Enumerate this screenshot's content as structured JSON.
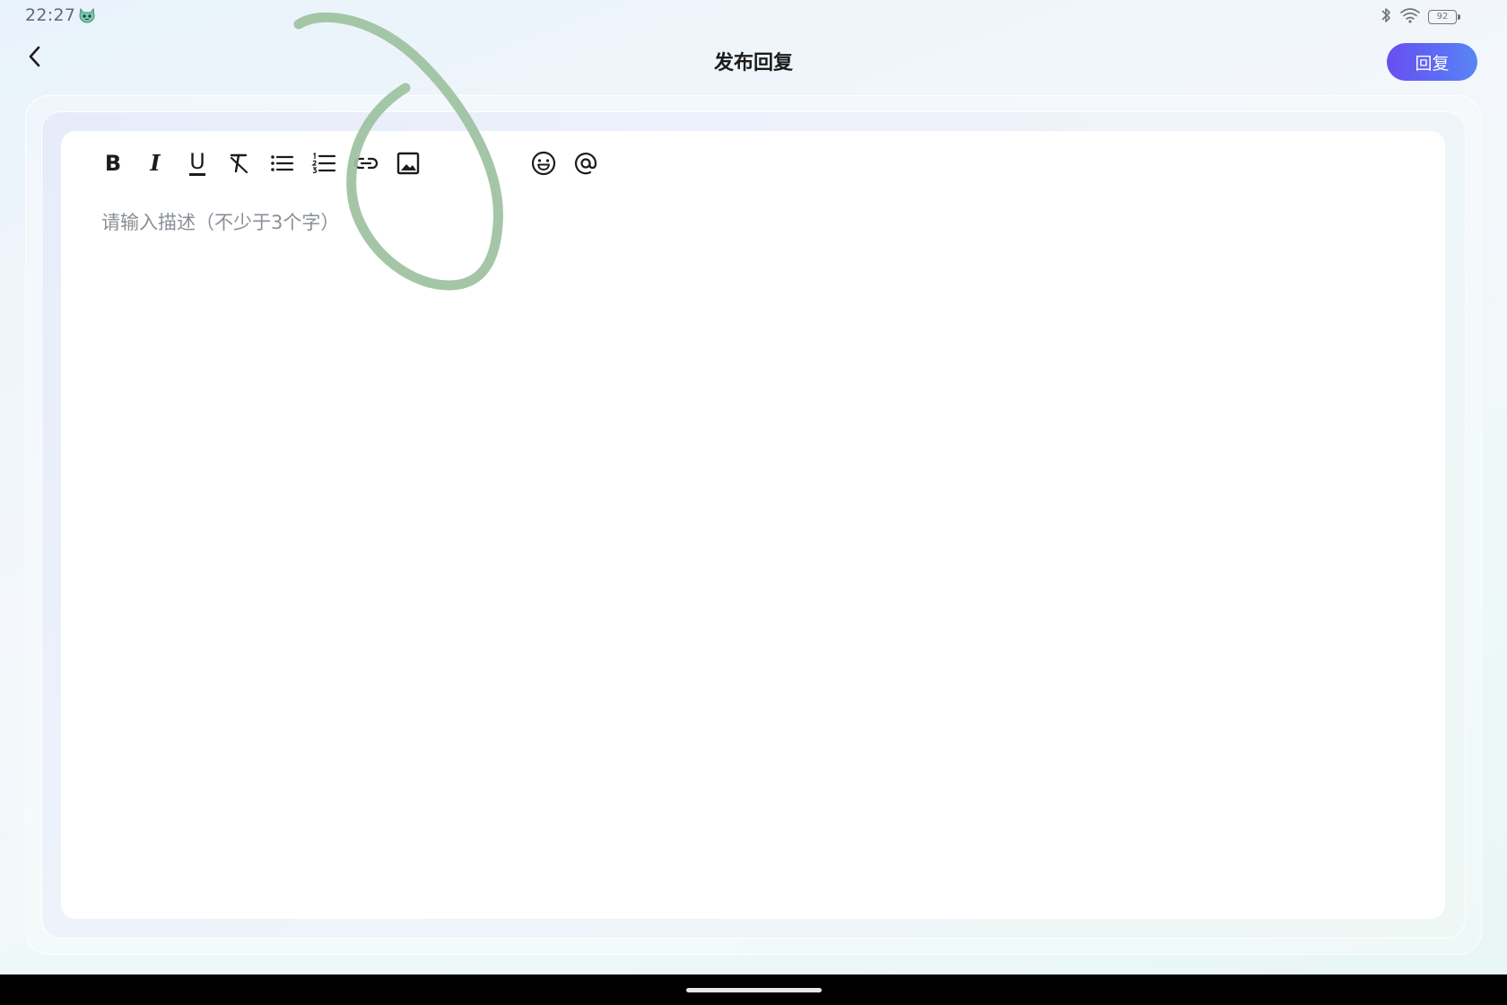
{
  "status_bar": {
    "time": "22:27",
    "app_icon": "cartoon-cat-icon",
    "icons": [
      "bluetooth-icon",
      "wifi-icon",
      "battery-icon"
    ],
    "battery_level": "92"
  },
  "header": {
    "back_icon": "chevron-left-icon",
    "title": "发布回复",
    "reply_button_label": "回复",
    "reply_button_color": "#6353f2"
  },
  "editor": {
    "toolbar": [
      {
        "name": "bold",
        "icon": "bold-icon",
        "letter": "B"
      },
      {
        "name": "italic",
        "icon": "italic-icon",
        "letter": "I"
      },
      {
        "name": "underline",
        "icon": "underline-icon",
        "letter": "U"
      },
      {
        "name": "clear-format",
        "icon": "clear-format-icon"
      },
      {
        "name": "bullet-list",
        "icon": "bullet-list-icon"
      },
      {
        "name": "numbered-list",
        "icon": "numbered-list-icon"
      },
      {
        "name": "link",
        "icon": "link-icon"
      },
      {
        "name": "image",
        "icon": "image-icon"
      },
      {
        "name": "emoji",
        "icon": "emoji-icon"
      },
      {
        "name": "mention",
        "icon": "at-mention-icon"
      }
    ],
    "placeholder": "请输入描述（不少于3个字）",
    "value": ""
  },
  "annotation": {
    "shape": "hand-drawn-loop",
    "color": "#9cc19f"
  },
  "colors": {
    "accent": "#6353f2",
    "background": "#eef5fa",
    "nav_bar": "#000000"
  }
}
